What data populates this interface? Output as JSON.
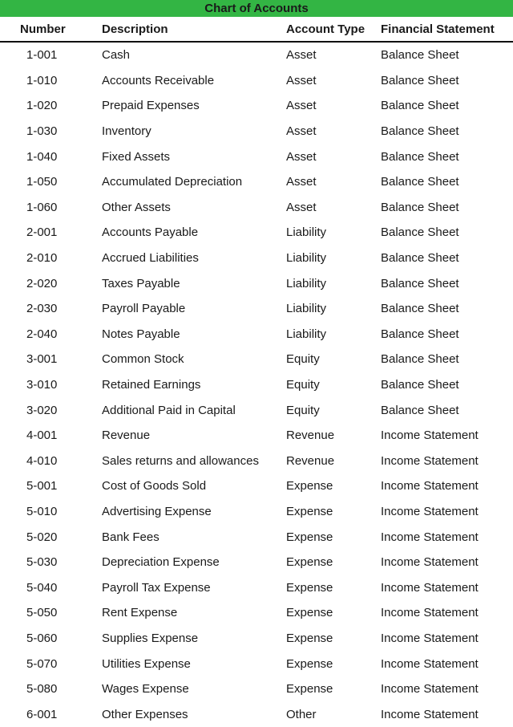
{
  "title": "Chart of Accounts",
  "headers": {
    "number": "Number",
    "description": "Description",
    "account_type": "Account Type",
    "financial_statement": "Financial Statement"
  },
  "rows": [
    {
      "number": "1-001",
      "description": "Cash",
      "account_type": "Asset",
      "financial_statement": "Balance Sheet"
    },
    {
      "number": "1-010",
      "description": "Accounts Receivable",
      "account_type": "Asset",
      "financial_statement": "Balance Sheet"
    },
    {
      "number": "1-020",
      "description": "Prepaid Expenses",
      "account_type": "Asset",
      "financial_statement": "Balance Sheet"
    },
    {
      "number": "1-030",
      "description": "Inventory",
      "account_type": "Asset",
      "financial_statement": "Balance Sheet"
    },
    {
      "number": "1-040",
      "description": "Fixed Assets",
      "account_type": "Asset",
      "financial_statement": "Balance Sheet"
    },
    {
      "number": "1-050",
      "description": "Accumulated Depreciation",
      "account_type": "Asset",
      "financial_statement": "Balance Sheet"
    },
    {
      "number": "1-060",
      "description": "Other Assets",
      "account_type": "Asset",
      "financial_statement": "Balance Sheet"
    },
    {
      "number": "2-001",
      "description": "Accounts Payable",
      "account_type": "Liability",
      "financial_statement": "Balance Sheet"
    },
    {
      "number": "2-010",
      "description": "Accrued Liabilities",
      "account_type": "Liability",
      "financial_statement": "Balance Sheet"
    },
    {
      "number": "2-020",
      "description": "Taxes Payable",
      "account_type": "Liability",
      "financial_statement": "Balance Sheet"
    },
    {
      "number": "2-030",
      "description": "Payroll Payable",
      "account_type": "Liability",
      "financial_statement": "Balance Sheet"
    },
    {
      "number": "2-040",
      "description": "Notes Payable",
      "account_type": "Liability",
      "financial_statement": "Balance Sheet"
    },
    {
      "number": "3-001",
      "description": "Common Stock",
      "account_type": "Equity",
      "financial_statement": "Balance Sheet"
    },
    {
      "number": "3-010",
      "description": "Retained Earnings",
      "account_type": "Equity",
      "financial_statement": "Balance Sheet"
    },
    {
      "number": "3-020",
      "description": "Additional Paid in Capital",
      "account_type": "Equity",
      "financial_statement": "Balance Sheet"
    },
    {
      "number": "4-001",
      "description": "Revenue",
      "account_type": "Revenue",
      "financial_statement": "Income Statement"
    },
    {
      "number": "4-010",
      "description": "Sales returns and allowances",
      "account_type": "Revenue",
      "financial_statement": "Income Statement"
    },
    {
      "number": "5-001",
      "description": "Cost of Goods Sold",
      "account_type": "Expense",
      "financial_statement": "Income Statement"
    },
    {
      "number": "5-010",
      "description": "Advertising Expense",
      "account_type": "Expense",
      "financial_statement": "Income Statement"
    },
    {
      "number": "5-020",
      "description": "Bank Fees",
      "account_type": "Expense",
      "financial_statement": "Income Statement"
    },
    {
      "number": "5-030",
      "description": "Depreciation Expense",
      "account_type": "Expense",
      "financial_statement": "Income Statement"
    },
    {
      "number": "5-040",
      "description": "Payroll Tax Expense",
      "account_type": "Expense",
      "financial_statement": "Income Statement"
    },
    {
      "number": "5-050",
      "description": "Rent Expense",
      "account_type": "Expense",
      "financial_statement": "Income Statement"
    },
    {
      "number": "5-060",
      "description": "Supplies Expense",
      "account_type": "Expense",
      "financial_statement": "Income Statement"
    },
    {
      "number": "5-070",
      "description": "Utilities Expense",
      "account_type": "Expense",
      "financial_statement": "Income Statement"
    },
    {
      "number": "5-080",
      "description": "Wages Expense",
      "account_type": "Expense",
      "financial_statement": "Income Statement"
    },
    {
      "number": "6-001",
      "description": "Other Expenses",
      "account_type": "Other",
      "financial_statement": "Income Statement"
    }
  ],
  "colors": {
    "title_bar": "#33b544"
  }
}
